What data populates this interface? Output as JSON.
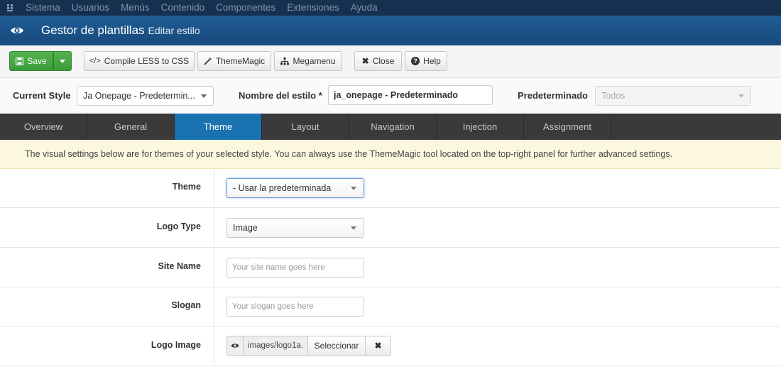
{
  "nav": {
    "items": [
      "Sistema",
      "Usuarios",
      "Menús",
      "Contenido",
      "Componentes",
      "Extensiones",
      "Ayuda"
    ]
  },
  "header": {
    "title": "Gestor de plantillas",
    "subtitle": "Editar estilo"
  },
  "toolbar": {
    "save_label": "Save",
    "compile_label": "Compile LESS to CSS",
    "compile_icon": "</>",
    "thememagic_label": "ThemeMagic",
    "megamenu_label": "Megamenu",
    "close_label": "Close",
    "help_label": "Help"
  },
  "style_row": {
    "current_style_label": "Current Style",
    "current_style_value": "Ja Onepage - Predetermin...",
    "style_name_label": "Nombre del estilo *",
    "style_name_value": "ja_onepage - Predeterminado",
    "default_label": "Predeterminado",
    "default_value": "Todos"
  },
  "tabs": [
    {
      "label": "Overview"
    },
    {
      "label": "General"
    },
    {
      "label": "Theme"
    },
    {
      "label": "Layout"
    },
    {
      "label": "Navigation"
    },
    {
      "label": "Injection"
    },
    {
      "label": "Assignment"
    }
  ],
  "active_tab": "Theme",
  "banner": {
    "text": "The visual settings below are for themes of your selected style. You can always use the ThemeMagic tool located on the top-right panel for further advanced settings."
  },
  "form": {
    "theme": {
      "label": "Theme",
      "value": "- Usar la predeterminada"
    },
    "logo_type": {
      "label": "Logo Type",
      "value": "Image"
    },
    "site_name": {
      "label": "Site Name",
      "placeholder": "Your site name goes here"
    },
    "slogan": {
      "label": "Slogan",
      "placeholder": "Your slogan goes here"
    },
    "logo_image": {
      "label": "Logo Image",
      "path": "images/logo1a.",
      "select_label": "Seleccionar",
      "clear_label": "✖"
    }
  },
  "colors": {
    "nav_bg": "#16304f",
    "header_bg": "#1f5d96",
    "save_green": "#3a9a39",
    "tab_bar": "#3a3a3a",
    "tab_active": "#1b72b0",
    "banner_bg": "#fcf8e0"
  }
}
